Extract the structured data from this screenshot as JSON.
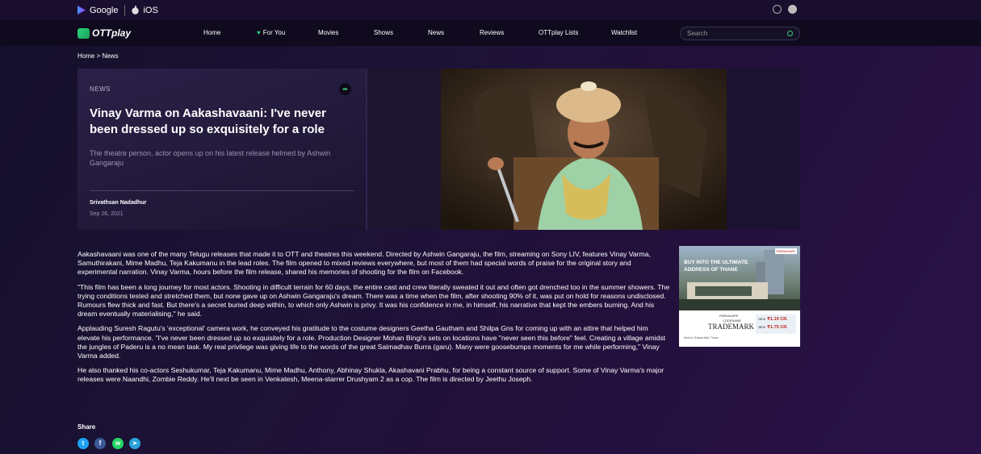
{
  "topbar": {
    "google_label": "Google",
    "ios_label": "iOS"
  },
  "navbar": {
    "logo_text": "OTTplay",
    "items": [
      "Home",
      "For You",
      "Movies",
      "Shows",
      "News",
      "Reviews",
      "OTTplay Lists",
      "Watchlist"
    ],
    "search_placeholder": "Search"
  },
  "breadcrumb": "Home > News",
  "hero": {
    "tag": "NEWS",
    "title": "Vinay Varma on Aakashavaani: I've never been dressed up so exquisitely for a role",
    "subtitle": "The theatre person, actor opens up on his latest release helmed by Ashwin Gangaraju",
    "author": "Srivathsan Nadadhur",
    "date": "Sep 26, 2021"
  },
  "article": {
    "paragraphs": [
      "Aakashavaani was one of the many Telugu releases that made it to OTT and theatres this weekend. Directed by Ashwin Gangaraju, the film, streaming on Sony LIV, features Vinay Varma, Samuthirakani, Mime Madhu, Teja Kakumanu in the lead roles. The film opened to mixed reviews everywhere, but most of them had special words of praise for the original story and experimental narration. Vinay Varma, hours before the film release, shared his memories of shooting for the film on Facebook.",
      "\"This film has been a long journey for most actors. Shooting in difficult terrain for 60 days, the entire cast and crew literally sweated it out and often got drenched too in the summer showers. The trying conditions tested and stretched them, but none gave up on Ashwin Gangaraju's dream. There was a time when the film, after shooting 90% of it, was put on hold for reasons undisclosed. Rumours flew thick and fast. But there's a secret buried deep within, to which only Ashwin is privy. It was his confidence in me, in himself, his narrative that kept the embers burning. And his dream eventually materialising,\" he said.",
      "Applauding Suresh Ragutu's 'exceptional' camera work, he conveyed his gratitude to the costume designers Geetha Gautham and Shilpa Gns for coming up with an attire that helped him elevate his performance. \"I've never been dressed up so exquisitely for a role. Production Designer Mohan Bingi's sets on locations have \"never seen this before\" feel. Creating a village amidst the jungles of Paderu is a no mean task. My real privilege was giving life to the words of the great Saimadhav Burra (garu). Many were goosebumps moments for me while performing,\" Vinay Varma added.",
      "He also thanked his co-actors Seshukumar, Teja Kakumanu, Mime Madhu, Anthony, Abhinay Shukla, Akashavani Prabhu, for being a constant source of support. Some of Vinay Varma's major releases were Naandhi, Zombie Reddy. He'll next be seen in Venkatesh, Meena-starrer Drushyam 2 as a cop. The film is directed by Jeethu Joseph."
    ],
    "share_label": "Share"
  },
  "ad": {
    "headline_1": "BUY INTO THE ULTIMATE",
    "headline_2": "ADDRESS OF THANE",
    "logo": "PARANJAPE",
    "brand": "PARANJAPE",
    "codename": "CODENAME",
    "trademark": "TRADEMARK",
    "sub": "Next to Viviana Mall, Thane",
    "price_1_label": "2BHK",
    "price_1": "₹1.19 CR.",
    "price_2_label": "3BHK",
    "price_2": "₹1.75 CR."
  },
  "colors": {
    "accent_green": "#33d07a",
    "navbar_bg": "#0f0a1d",
    "twitter": "#1da1f2",
    "facebook": "#3b5998",
    "whatsapp": "#25d366",
    "telegram": "#2aa3db"
  }
}
